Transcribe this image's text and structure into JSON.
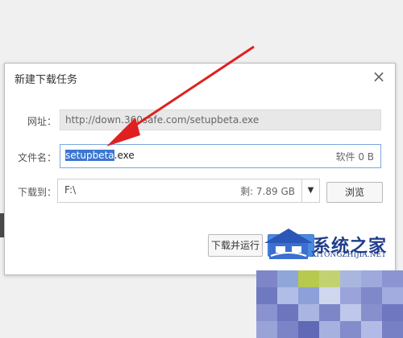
{
  "dialog": {
    "title": "新建下载任务",
    "close_glyph": "×"
  },
  "url_row": {
    "label": "网址：",
    "value": "http://down.360safe.com/setupbeta.exe"
  },
  "filename_row": {
    "label": "文件名：",
    "name_selected": "setupbeta",
    "extension": ".exe",
    "type_and_size": "软件 0 B"
  },
  "destination_row": {
    "label": "下载到：",
    "path": "F:\\",
    "free_space": "剩: 7.89 GB",
    "dropdown_glyph": "▼",
    "browse_label": "浏览"
  },
  "actions": {
    "download_and_run_label": "下载并运行",
    "download_label": ""
  },
  "watermark": {
    "title": "系统之家",
    "subtitle": "XITONGZHIJIA.NET"
  },
  "colors": {
    "accent_blue": "#4a8ae0",
    "selection_blue": "#3b76d1",
    "annotation_red": "#e02020"
  },
  "icons": {
    "close": "close-icon",
    "dropdown": "chevron-down-icon",
    "arrow": "annotation-arrow"
  }
}
